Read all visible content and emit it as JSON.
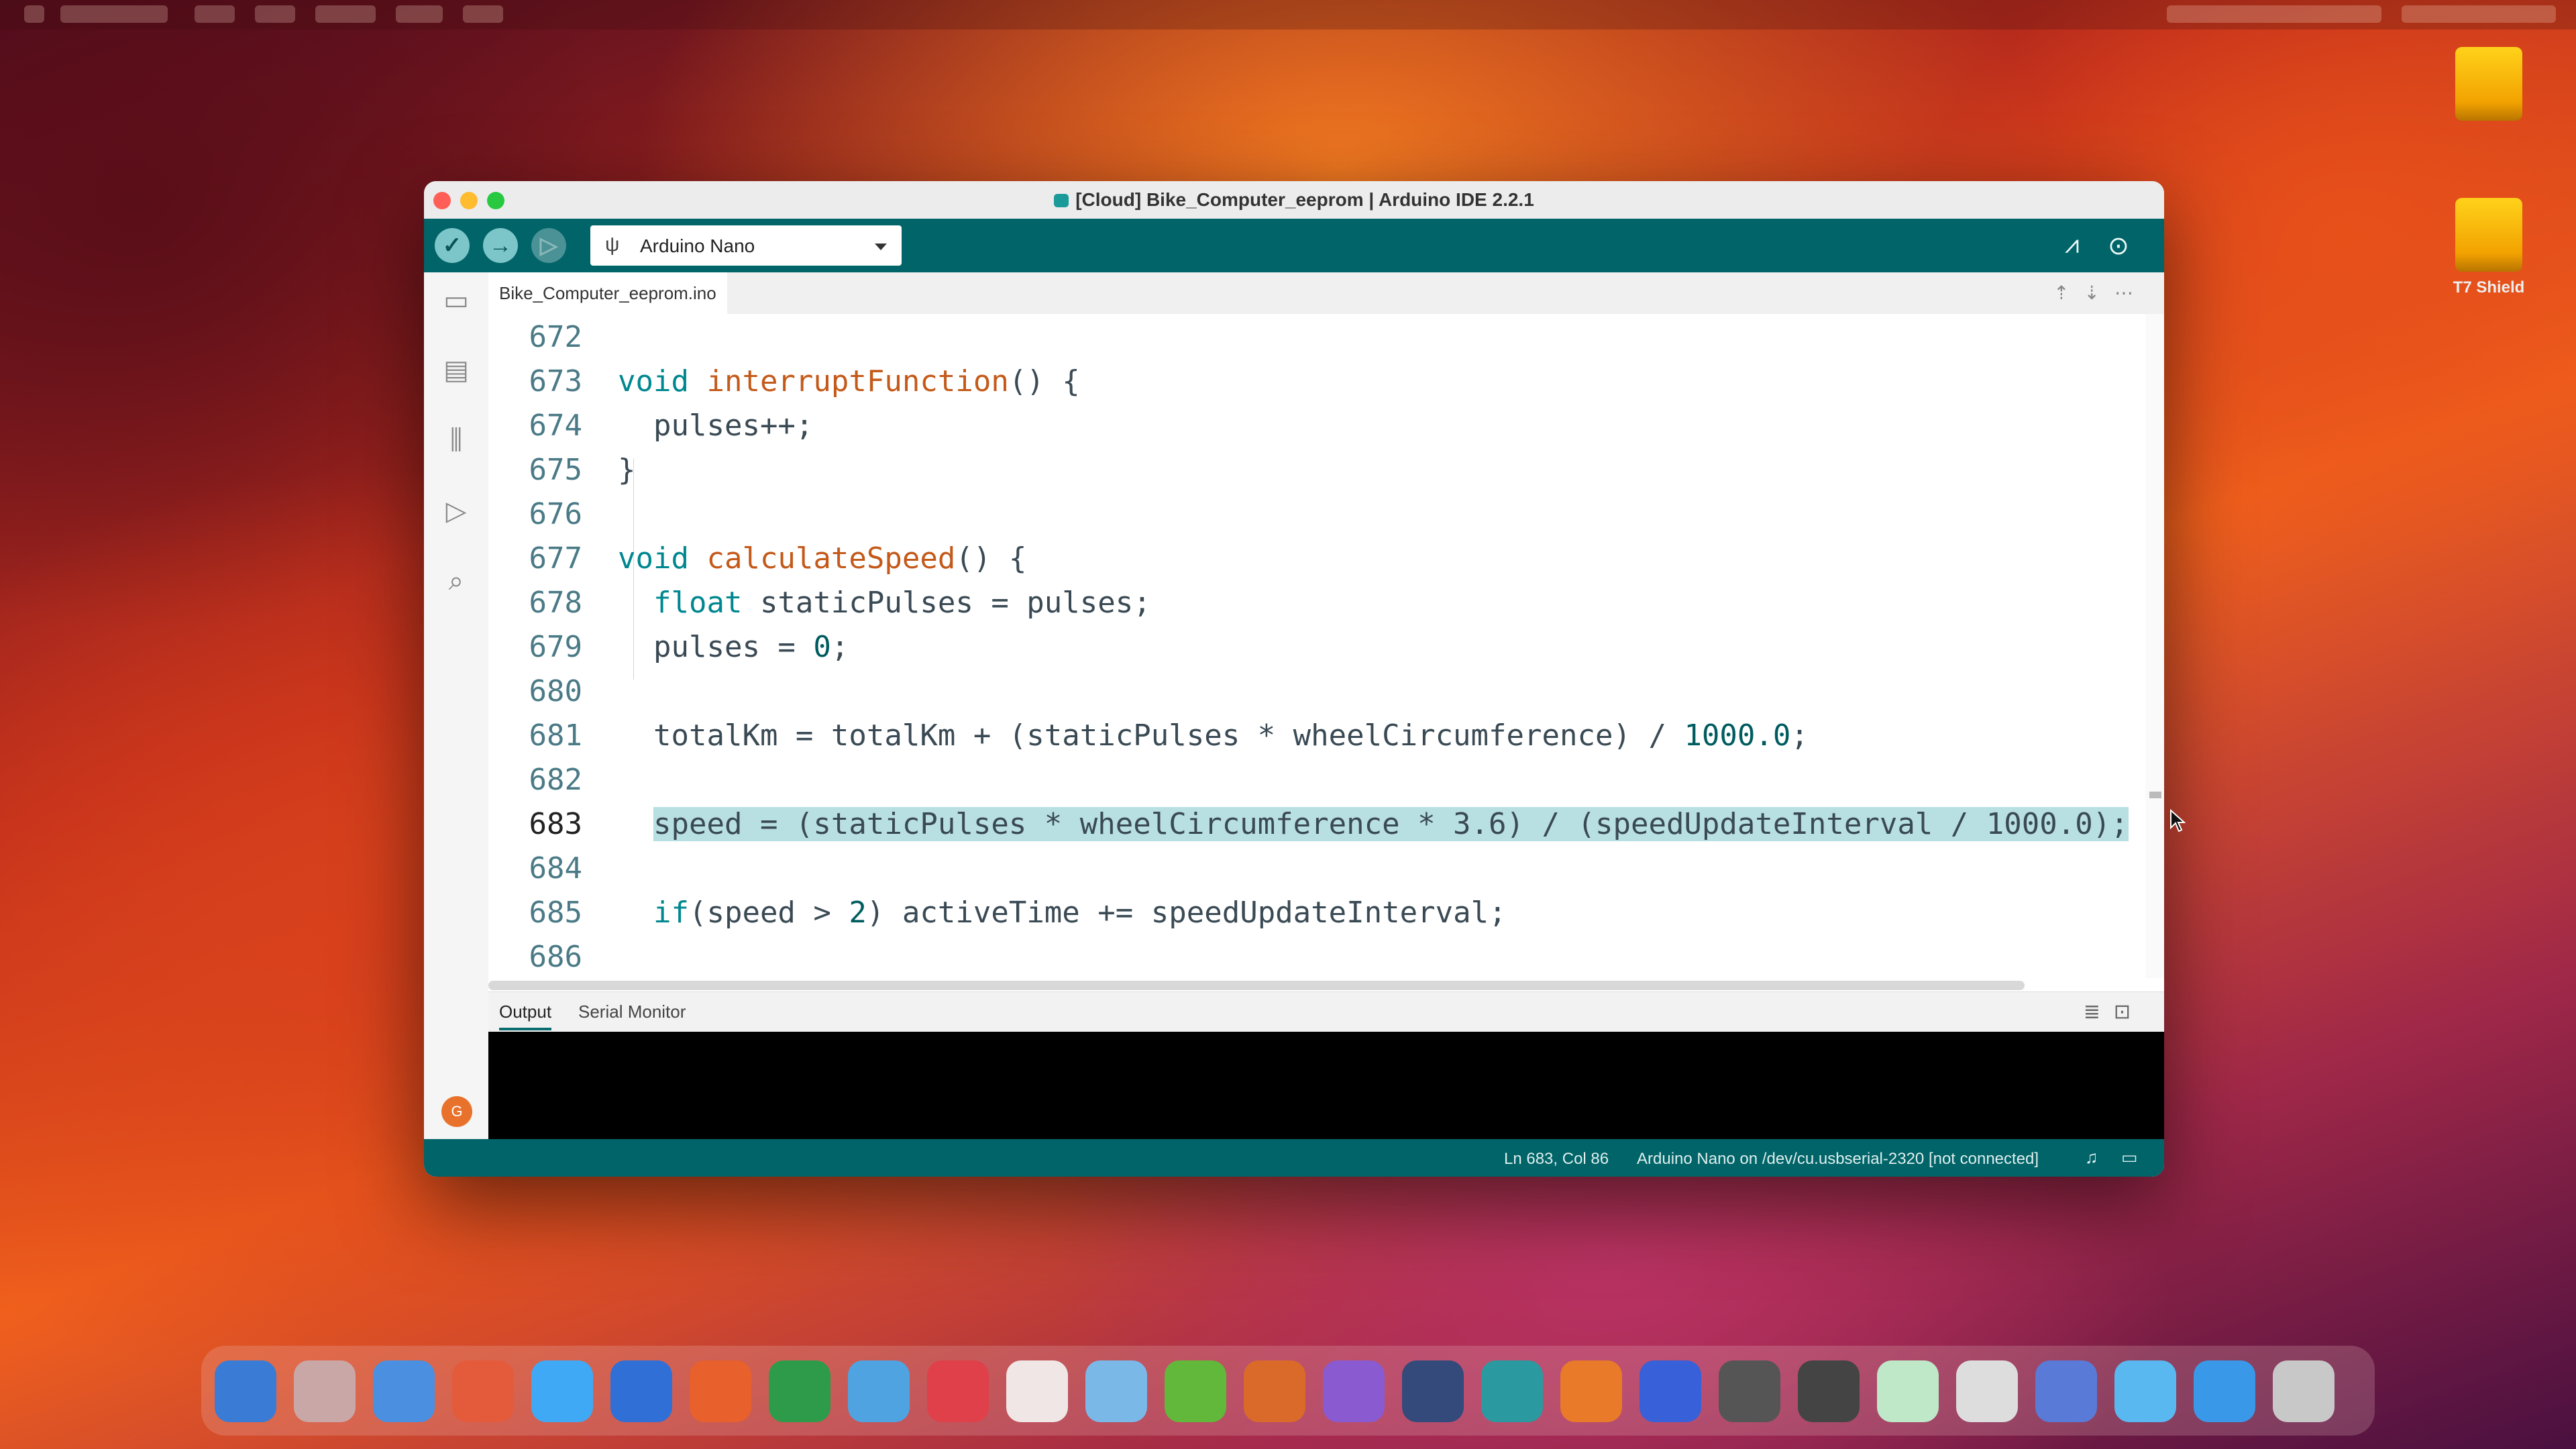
{
  "window": {
    "title": "[Cloud] Bike_Computer_eeprom | Arduino IDE 2.2.1"
  },
  "toolbar": {
    "verify_icon": "check-icon",
    "upload_icon": "arrow-right-icon",
    "debug_icon": "debug-icon",
    "board_name": "Arduino Nano",
    "plotter_icon": "serial-plotter-icon",
    "monitor_icon": "serial-monitor-icon"
  },
  "desktop": {
    "icons": [
      {
        "label": "",
        "icon": "drive-icon"
      },
      {
        "label": "T7 Shield",
        "icon": "drive-icon"
      }
    ]
  },
  "sidebar": {
    "items": [
      {
        "name": "sketchbook",
        "icon": "folder-icon"
      },
      {
        "name": "boards-manager",
        "icon": "board-icon"
      },
      {
        "name": "library-manager",
        "icon": "library-icon"
      },
      {
        "name": "debug",
        "icon": "debug-icon"
      },
      {
        "name": "search",
        "icon": "search-icon"
      }
    ],
    "avatar_initials": "G"
  },
  "editor": {
    "tab": "Bike_Computer_eeprom.ino",
    "lines": [
      {
        "n": "672"
      },
      {
        "n": "673",
        "kw": "void",
        "fn": "interruptFunction",
        "rest": "() {"
      },
      {
        "n": "674",
        "text": "pulses++;"
      },
      {
        "n": "675",
        "text": "}"
      },
      {
        "n": "676"
      },
      {
        "n": "677",
        "kw": "void",
        "fn": "calculateSpeed",
        "rest": "() {"
      },
      {
        "n": "678",
        "kw": "float",
        "rest": " staticPulses = pulses;"
      },
      {
        "n": "679",
        "pre": "pulses = ",
        "num": "0",
        "post": ";"
      },
      {
        "n": "680"
      },
      {
        "n": "681",
        "pre": "totalKm = totalKm + (staticPulses * wheelCircumference) / ",
        "num": "1000.0",
        "post": ";"
      },
      {
        "n": "682"
      },
      {
        "n": "683",
        "text": "speed = (staticPulses * wheelCircumference * 3.6) / (speedUpdateInterval / 1000.0);"
      },
      {
        "n": "684"
      },
      {
        "n": "685",
        "kw": "if",
        "pre": "(speed > ",
        "num": "2",
        "post": ") activeTime += speedUpdateInterval;"
      },
      {
        "n": "686"
      }
    ]
  },
  "panel": {
    "tabs": [
      "Output",
      "Serial Monitor"
    ]
  },
  "status": {
    "position": "Ln 683, Col 86",
    "connection": "Arduino Nano on /dev/cu.usbserial-2320 [not connected]"
  },
  "colors": {
    "accent": "#006468",
    "selection": "#b8dfe1",
    "keyword": "#00878f",
    "function": "#c45a1a"
  }
}
